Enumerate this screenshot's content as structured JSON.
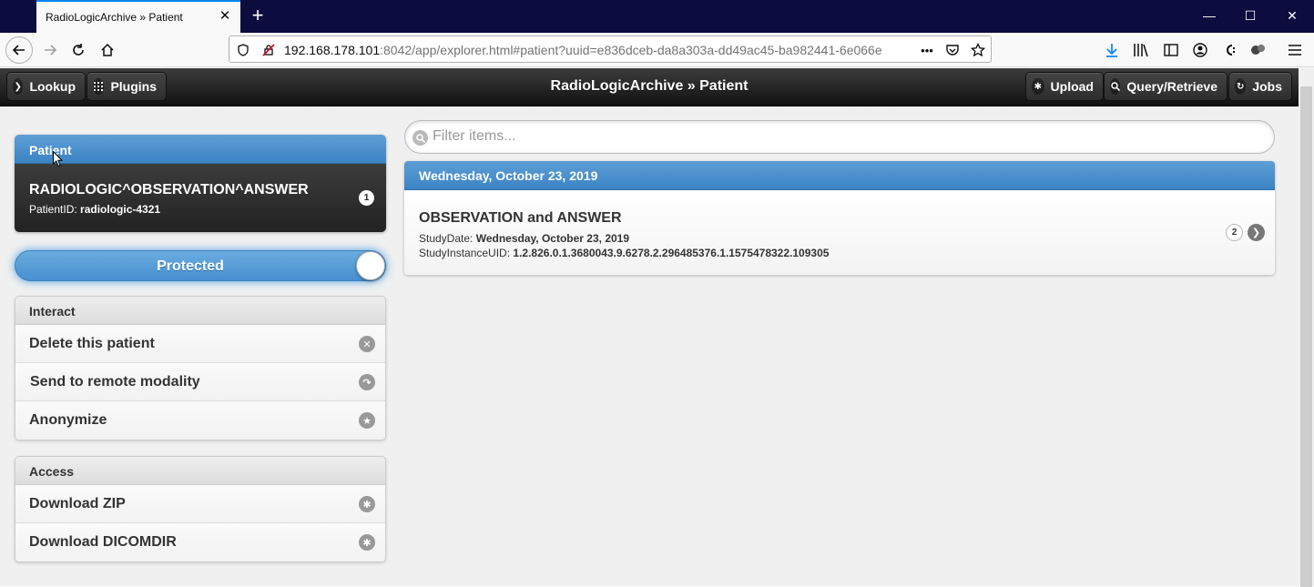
{
  "browser": {
    "tab_title": "RadioLogicArchive » Patient",
    "url_host": "192.168.178.101",
    "url_rest": ":8042/app/explorer.html#patient?uuid=e836dceb-da8a303a-dd49ac45-ba982441-6e066e",
    "url_more": "•••"
  },
  "header": {
    "title": "RadioLogicArchive » Patient",
    "lookup_label": "Lookup",
    "plugins_label": "Plugins",
    "upload_label": "Upload",
    "query_label": "Query/Retrieve",
    "jobs_label": "Jobs"
  },
  "patient": {
    "header": "Patient",
    "name": "RADIOLOGIC^OBSERVATION^ANSWER",
    "id_label": "PatientID:",
    "id_value": "radiologic-4321",
    "study_count": "1"
  },
  "protection": {
    "label": "Protected"
  },
  "interact": {
    "header": "Interact",
    "items": [
      {
        "label": "Delete this patient",
        "icon": "delete-icon"
      },
      {
        "label": "Send to remote modality",
        "icon": "forward-icon"
      },
      {
        "label": "Anonymize",
        "icon": "star-icon"
      }
    ]
  },
  "access": {
    "header": "Access",
    "items": [
      {
        "label": "Download ZIP",
        "icon": "gear-icon"
      },
      {
        "label": "Download DICOMDIR",
        "icon": "gear-icon"
      }
    ]
  },
  "filter": {
    "placeholder": "Filter items..."
  },
  "studies": {
    "date_header": "Wednesday, October 23, 2019",
    "items": [
      {
        "title": "OBSERVATION and ANSWER",
        "date_label": "StudyDate:",
        "date_value": "Wednesday, October 23, 2019",
        "uid_label": "StudyInstanceUID:",
        "uid_value": "1.2.826.0.1.3680043.9.6278.2.296485376.1.1575478322.109305",
        "series_count": "2"
      }
    ]
  }
}
